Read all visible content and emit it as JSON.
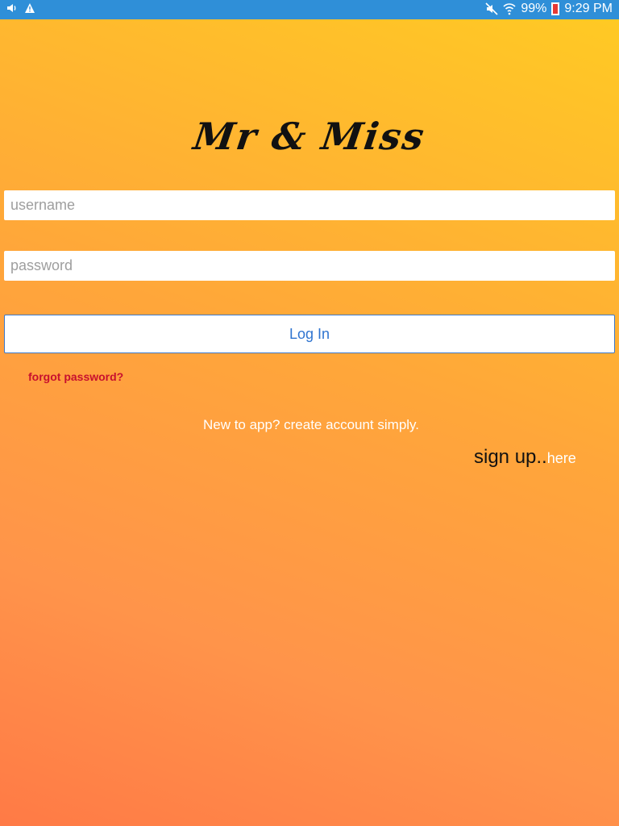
{
  "status_bar": {
    "battery_percent": "99%",
    "time": "9:29 PM",
    "icons": [
      "volume-icon",
      "warning-icon",
      "mute-icon",
      "wifi-icon",
      "battery-icon"
    ]
  },
  "app": {
    "logo_text": "Mr & Miss"
  },
  "form": {
    "username_placeholder": "username",
    "password_placeholder": "password",
    "login_label": "Log In",
    "forgot_label": "forgot password?"
  },
  "signup": {
    "prompt": "New to app? create account simply.",
    "label": "sign up..",
    "link": "here"
  },
  "colors": {
    "status_bar": "#2f8fd8",
    "gradient_top": "#ffcb23",
    "gradient_bottom": "#ff7a46",
    "login_text": "#2f74d0",
    "forgot_text": "#c8102e"
  }
}
